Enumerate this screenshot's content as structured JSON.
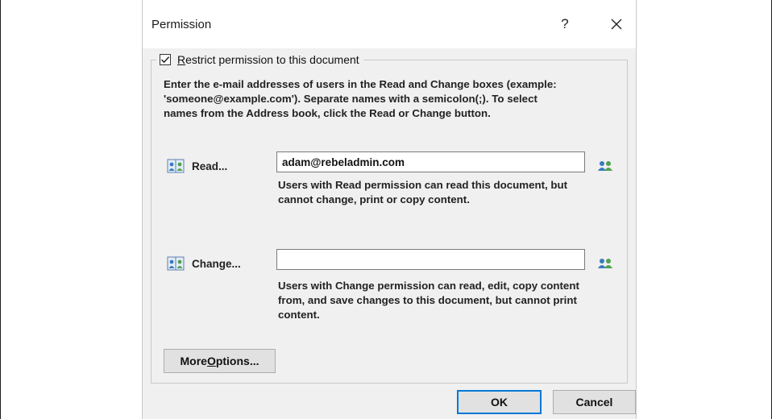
{
  "dialog": {
    "title": "Permission",
    "help_label": "?",
    "restrict": {
      "checked": true,
      "label_accesskey": "R",
      "label_rest": "estrict permission to this document"
    },
    "instructions": "Enter the e-mail addresses of users in the Read and Change boxes (example:\n'someone@example.com'). Separate names with a semicolon(;). To select\nnames from the Address book, click the Read or Change button.",
    "read": {
      "button_label": "Read...",
      "value": "adam@rebeladmin.com",
      "description": "Users with Read permission can read this document, but cannot change, print or copy content."
    },
    "change": {
      "button_label": "Change...",
      "value": "",
      "description": "Users with Change permission can read, edit, copy content from, and save changes to this document, but cannot print content."
    },
    "more_options": {
      "prefix": "More ",
      "accesskey": "O",
      "rest": "ptions..."
    },
    "ok_label": "OK",
    "cancel_label": "Cancel"
  }
}
